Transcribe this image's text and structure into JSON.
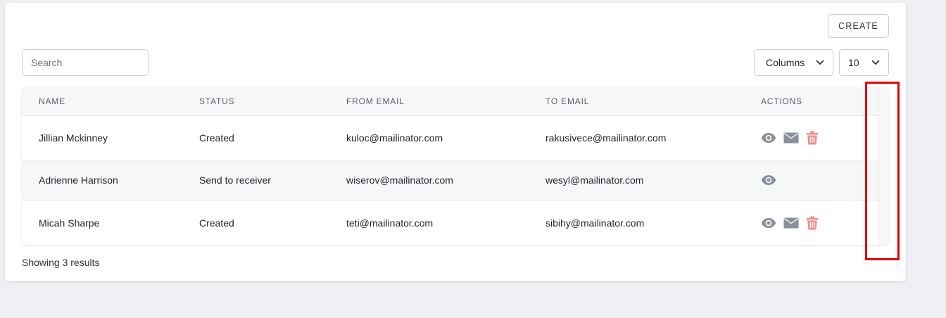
{
  "toolbar": {
    "create_label": "CREATE",
    "search_placeholder": "Search",
    "columns_label": "Columns",
    "page_size": "10"
  },
  "table": {
    "headers": [
      "NAME",
      "STATUS",
      "FROM EMAIL",
      "TO EMAIL",
      "ACTIONS"
    ],
    "rows": [
      {
        "name": "Jillian Mckinney",
        "status": "Created",
        "from_email": "kuloc@mailinator.com",
        "to_email": "rakusivece@mailinator.com",
        "actions": [
          "eye-icon",
          "envelope-icon",
          "trash-icon"
        ]
      },
      {
        "name": "Adrienne Harrison",
        "status": "Send to receiver",
        "from_email": "wiserov@mailinator.com",
        "to_email": "wesyl@mailinator.com",
        "actions": [
          "eye-icon"
        ]
      },
      {
        "name": "Micah Sharpe",
        "status": "Created",
        "from_email": "teti@mailinator.com",
        "to_email": "sibihy@mailinator.com",
        "actions": [
          "eye-icon",
          "envelope-icon",
          "trash-icon"
        ]
      }
    ]
  },
  "footer": {
    "results_text": "Showing 3 results"
  },
  "colors": {
    "icon_gray": "#8a9099",
    "trash_red": "#f28b8b",
    "highlight_red": "#e00000"
  }
}
